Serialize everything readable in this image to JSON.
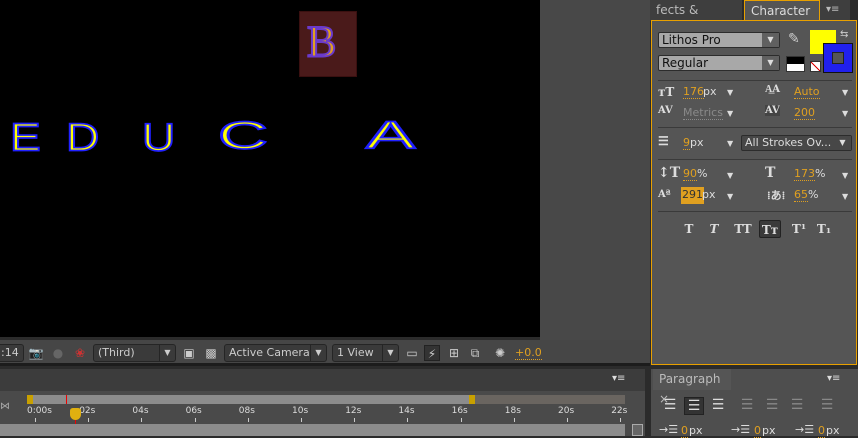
{
  "composition": {
    "letters": [
      "E",
      "D",
      "U",
      "C",
      "A"
    ],
    "logo_letter": "B"
  },
  "viewer_toolbar": {
    "time": ":14",
    "resolution": "(Third)",
    "camera": "Active Camera",
    "views": "1 View",
    "exposure": "+0.0"
  },
  "panels": {
    "effects_tab": "fects & Presets",
    "character_tab": "Character",
    "paragraph_tab": "Paragraph",
    "close": "×",
    "menu": "▾≡"
  },
  "character": {
    "font_family": "Lithos Pro",
    "font_style": "Regular",
    "fill_color": "#ffff00",
    "stroke_color": "#2020ee",
    "font_size": "176",
    "font_size_unit": "px",
    "leading": "Auto",
    "kerning": "Metrics",
    "tracking": "200",
    "stroke_width": "9",
    "stroke_unit": "px",
    "stroke_mode": "All Strokes Ov...",
    "vertical_scale": "90",
    "vertical_unit": "%",
    "horizontal_scale": "173",
    "horizontal_unit": "%",
    "baseline_shift": "291",
    "baseline_unit": "px",
    "tsume": "65",
    "tsume_unit": "%",
    "format_buttons": [
      "T",
      "T",
      "TT",
      "Tт",
      "T¹",
      "T₁"
    ]
  },
  "timeline": {
    "ticks": [
      "0:00s",
      "02s",
      "04s",
      "06s",
      "08s",
      "10s",
      "12s",
      "14s",
      "16s",
      "18s",
      "20s",
      "22s"
    ]
  },
  "paragraph": {
    "indent_values": [
      "0",
      "0",
      "0"
    ],
    "unit": "px"
  }
}
